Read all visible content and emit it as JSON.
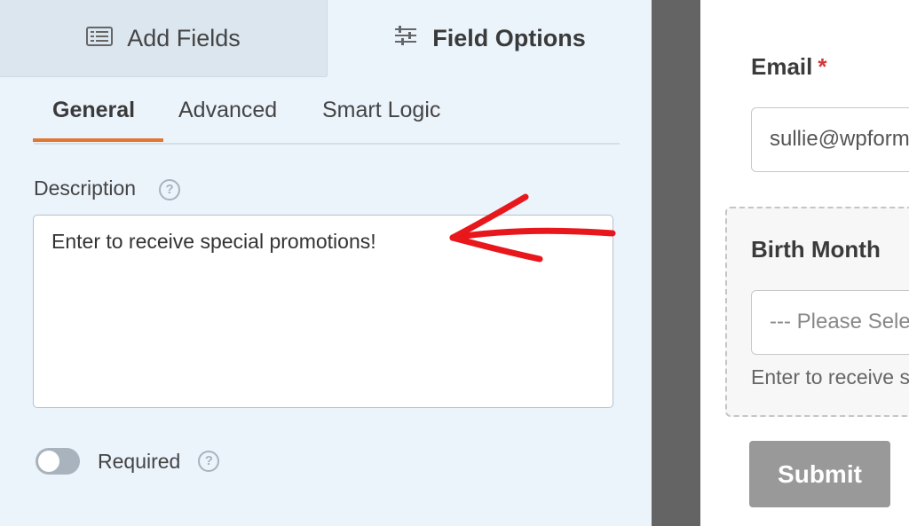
{
  "tabs": {
    "add_fields": "Add Fields",
    "field_options": "Field Options"
  },
  "subtabs": {
    "general": "General",
    "advanced": "Advanced",
    "smart_logic": "Smart Logic"
  },
  "field_options": {
    "description_label": "Description",
    "description_value": "Enter to receive special promotions!",
    "required_label": "Required",
    "required_on": false
  },
  "preview": {
    "email_label": "Email",
    "required_marker": "*",
    "email_value": "sullie@wpforms.com",
    "birth_month_label": "Birth Month",
    "select_placeholder": "--- Please Select ---",
    "field_description": "Enter to receive special promotions!",
    "submit_label": "Submit"
  },
  "colors": {
    "accent": "#e27730",
    "annotation_arrow": "#e8171b",
    "required_star": "#d63638"
  }
}
